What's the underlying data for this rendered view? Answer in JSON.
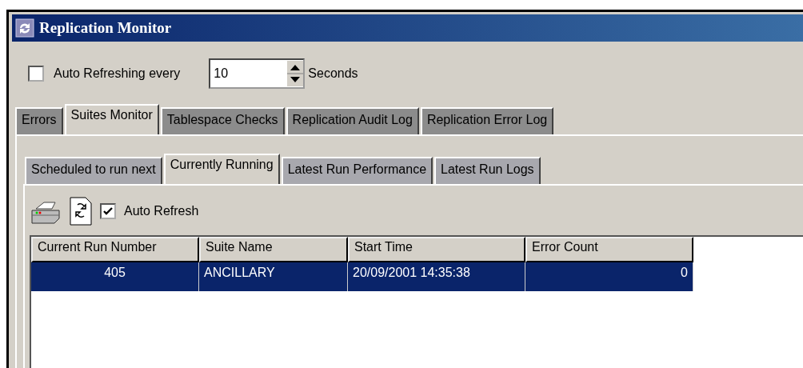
{
  "window": {
    "title": "Replication Monitor"
  },
  "auto_refresh": {
    "checked": false,
    "label": "Auto Refreshing every",
    "value": "10",
    "unit": "Seconds"
  },
  "tabs": [
    {
      "label": "Errors",
      "selected": false
    },
    {
      "label": "Suites Monitor",
      "selected": true
    },
    {
      "label": "Tablespace Checks",
      "selected": false
    },
    {
      "label": "Replication Audit Log",
      "selected": false
    },
    {
      "label": "Replication Error Log",
      "selected": false
    }
  ],
  "subtabs": [
    {
      "label": "Scheduled to run next",
      "selected": false
    },
    {
      "label": "Currently Running",
      "selected": true
    },
    {
      "label": "Latest Run Performance",
      "selected": false
    },
    {
      "label": "Latest Run Logs",
      "selected": false
    }
  ],
  "toolbar": {
    "auto_refresh": {
      "label": "Auto Refresh",
      "checked": true
    }
  },
  "table": {
    "columns": [
      {
        "label": "Current Run Number"
      },
      {
        "label": "Suite Name"
      },
      {
        "label": "Start Time"
      },
      {
        "label": "Error Count"
      }
    ],
    "rows": [
      {
        "selected": true,
        "cells": [
          "405",
          "ANCILLARY",
          "20/09/2001 14:35:38",
          "0"
        ]
      }
    ]
  }
}
